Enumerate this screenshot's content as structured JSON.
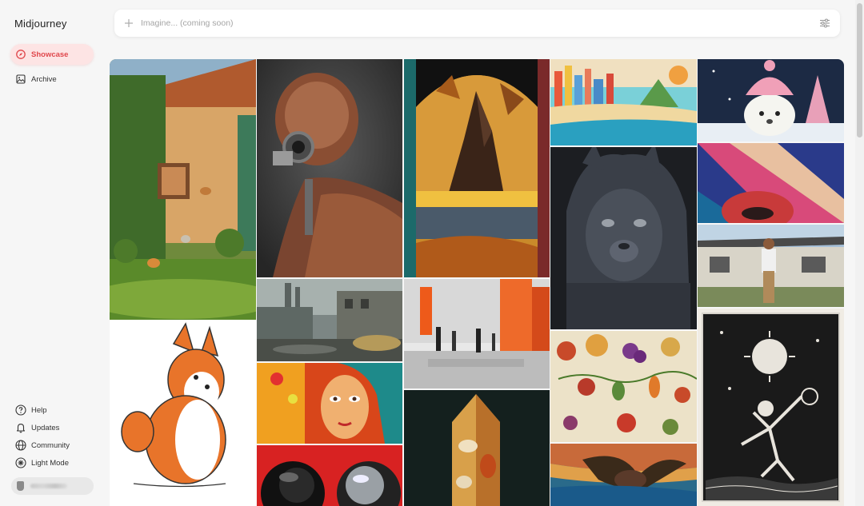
{
  "app": {
    "name": "Midjourney"
  },
  "nav": {
    "showcase": "Showcase",
    "archive": "Archive"
  },
  "search": {
    "placeholder": "Imagine... (coming soon)"
  },
  "footer_links": {
    "help": "Help",
    "updates": "Updates",
    "community": "Community",
    "light_mode": "Light Mode"
  },
  "colors": {
    "accent": "#e0474c",
    "accent_bg": "#fde4e4",
    "page_bg": "#f6f6f6"
  },
  "icons": {
    "showcase": "compass-icon",
    "archive": "image-icon",
    "help": "question-circle-icon",
    "updates": "bell-icon",
    "community": "globe-icon",
    "light_mode": "sun-icon",
    "search_add": "plus-icon",
    "filters": "sliders-icon"
  }
}
